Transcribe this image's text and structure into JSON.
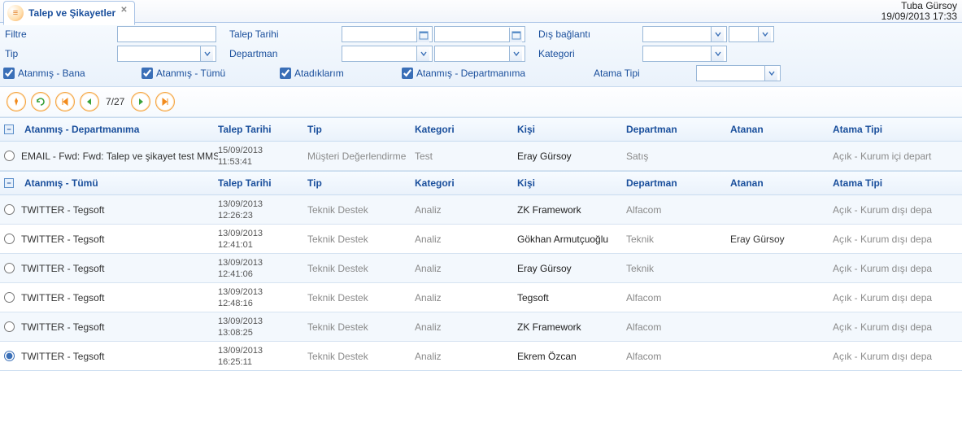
{
  "header": {
    "tab_title": "Talep ve Şikayetler",
    "user_name": "Tuba Gürsoy",
    "datetime": "19/09/2013 17:33"
  },
  "filters": {
    "filtre_label": "Filtre",
    "talep_tarihi_label": "Talep Tarihi",
    "dis_baglanti_label": "Dış bağlantı",
    "tip_label": "Tip",
    "departman_label": "Departman",
    "kategori_label": "Kategori",
    "atama_tipi_label": "Atama Tipi",
    "cb_atanmis_bana": "Atanmış - Bana",
    "cb_atanmis_tumu": "Atanmış - Tümü",
    "cb_atadiklarim": "Atadıklarım",
    "cb_atanmis_dept": "Atanmış - Departmanıma"
  },
  "pager": {
    "position": "7/27"
  },
  "groups": [
    {
      "title": "Atanmış - Departmanıma",
      "headers": {
        "talep_tarihi": "Talep Tarihi",
        "tip": "Tip",
        "kategori": "Kategori",
        "kisi": "Kişi",
        "departman": "Departman",
        "atanan": "Atanan",
        "atama_tipi": "Atama Tipi"
      },
      "rows": [
        {
          "selected": false,
          "name": "EMAIL - Fwd: Fwd: Talep ve şikayet test MMS",
          "date_line1": "15/09/2013",
          "date_line2": "11:53:41",
          "tip": "Müşteri Değerlendirme",
          "kategori": "Test",
          "kisi": "Eray Gürsoy",
          "departman": "Satış",
          "atanan": "",
          "atama_tipi": "Açık - Kurum içi depart"
        }
      ]
    },
    {
      "title": "Atanmış - Tümü",
      "headers": {
        "talep_tarihi": "Talep Tarihi",
        "tip": "Tip",
        "kategori": "Kategori",
        "kisi": "Kişi",
        "departman": "Departman",
        "atanan": "Atanan",
        "atama_tipi": "Atama Tipi"
      },
      "rows": [
        {
          "selected": false,
          "name": "TWITTER - Tegsoft",
          "date_line1": "13/09/2013",
          "date_line2": "12:26:23",
          "tip": "Teknik Destek",
          "kategori": "Analiz",
          "kisi": "ZK Framework",
          "departman": "Alfacom",
          "atanan": "",
          "atama_tipi": "Açık - Kurum dışı depa"
        },
        {
          "selected": false,
          "name": "TWITTER - Tegsoft",
          "date_line1": "13/09/2013",
          "date_line2": "12:41:01",
          "tip": "Teknik Destek",
          "kategori": "Analiz",
          "kisi": "Gökhan Armutçuoğlu",
          "departman": "Teknik",
          "atanan": "Eray Gürsoy",
          "atama_tipi": "Açık - Kurum dışı depa"
        },
        {
          "selected": false,
          "name": "TWITTER - Tegsoft",
          "date_line1": "13/09/2013",
          "date_line2": "12:41:06",
          "tip": "Teknik Destek",
          "kategori": "Analiz",
          "kisi": "Eray Gürsoy",
          "departman": "Teknik",
          "atanan": "",
          "atama_tipi": "Açık - Kurum dışı depa"
        },
        {
          "selected": false,
          "name": "TWITTER - Tegsoft",
          "date_line1": "13/09/2013",
          "date_line2": "12:48:16",
          "tip": "Teknik Destek",
          "kategori": "Analiz",
          "kisi": "Tegsoft",
          "departman": "Alfacom",
          "atanan": "",
          "atama_tipi": "Açık - Kurum dışı depa"
        },
        {
          "selected": false,
          "name": "TWITTER - Tegsoft",
          "date_line1": "13/09/2013",
          "date_line2": "13:08:25",
          "tip": "Teknik Destek",
          "kategori": "Analiz",
          "kisi": "ZK Framework",
          "departman": "Alfacom",
          "atanan": "",
          "atama_tipi": "Açık - Kurum dışı depa"
        },
        {
          "selected": true,
          "name": "TWITTER - Tegsoft",
          "date_line1": "13/09/2013",
          "date_line2": "16:25:11",
          "tip": "Teknik Destek",
          "kategori": "Analiz",
          "kisi": "Ekrem Özcan",
          "departman": "Alfacom",
          "atanan": "",
          "atama_tipi": "Açık - Kurum dışı depa"
        }
      ]
    }
  ]
}
